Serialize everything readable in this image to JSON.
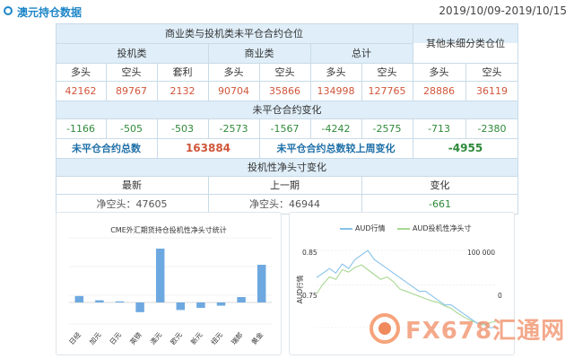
{
  "header": {
    "title": "澳元持仓数据",
    "date_range": "2019/10/09-2019/10/15"
  },
  "cot": {
    "row1": {
      "commercial_group": "商业类与投机类未平仓合约仓位",
      "other_group": "其他未细分类仓位"
    },
    "row2": {
      "speculative": "投机类",
      "commercial": "商业类",
      "total": "总计"
    },
    "row3": [
      "多头",
      "空头",
      "套利",
      "多头",
      "空头",
      "多头",
      "空头",
      "多头",
      "空头"
    ],
    "row4": [
      "42162",
      "89767",
      "2132",
      "90704",
      "35866",
      "134998",
      "127765",
      "28886",
      "36119"
    ],
    "row5": "未平仓合约变化",
    "row6": [
      "-1166",
      "-505",
      "-503",
      "-2573",
      "-1567",
      "-4242",
      "-2575",
      "-713",
      "-2380"
    ],
    "row7": {
      "oi_total_label": "未平仓合约总数",
      "oi_total_value": "163884",
      "oi_change_label": "未平仓合约总数较上周变化",
      "oi_change_value": "-4955"
    },
    "row8": "投机性净头寸变化",
    "row9": [
      "最新",
      "上一期",
      "变化"
    ],
    "row10": [
      "净空头：47605",
      "净空头：46944",
      "-661"
    ]
  },
  "colors": {
    "brand_blue": "#1e86c8",
    "table_blue_bg": "#dfeef8",
    "value_orange": "#d0563a",
    "change_green": "#2f8a3a",
    "bar_blue": "#6ea8e0",
    "line_blue": "#88c2ea",
    "line_green": "#a8d892"
  },
  "chart_left": {
    "title": "CME外汇期货持仓投机性净头寸统计"
  },
  "chart_right": {
    "legend_aud": "AUD行情",
    "legend_net": "AUD投机性净头寸",
    "left_top": "0.85",
    "left_mid": "0.75",
    "left_axis": "AUD行情",
    "right_top": "100 000",
    "right_mid": "0"
  },
  "watermark": {
    "text": "FX678汇通网"
  },
  "chart_data": [
    {
      "type": "bar",
      "title": "CME外汇期货持仓投机性净头寸统计",
      "categories": [
        "日经",
        "加元",
        "日元",
        "英镑",
        "澳元",
        "欧元",
        "新元",
        "纽元",
        "瑞郎",
        "黄金"
      ],
      "values": [
        12,
        4,
        2,
        -18,
        100,
        -14,
        -10,
        -6,
        10,
        70
      ],
      "ylim": [
        -40,
        120
      ],
      "grid": true
    },
    {
      "type": "line",
      "legend_position": "top",
      "series": [
        {
          "name": "AUD行情",
          "values": [
            0.79,
            0.8,
            0.81,
            0.8,
            0.82,
            0.81,
            0.83,
            0.84,
            0.85,
            0.83,
            0.82,
            0.81,
            0.8,
            0.79,
            0.78,
            0.77,
            0.76,
            0.76,
            0.75,
            0.74,
            0.73,
            0.73,
            0.72,
            0.71,
            0.7,
            0.69,
            0.69,
            0.68,
            0.68
          ]
        },
        {
          "name": "AUD投机性净头寸",
          "values": [
            10000,
            30000,
            45000,
            40000,
            60000,
            55000,
            65000,
            70000,
            60000,
            50000,
            40000,
            45000,
            35000,
            20000,
            15000,
            10000,
            5000,
            0,
            -5000,
            -8000,
            -15000,
            -20000,
            -30000,
            -38000,
            -45000,
            -50000,
            -55000,
            -50000,
            -47000
          ]
        }
      ],
      "y_left_ticks": [
        "0.85",
        "0.75"
      ],
      "y_right_ticks": [
        "100 000",
        "0"
      ],
      "ylabel": "AUD行情"
    }
  ]
}
